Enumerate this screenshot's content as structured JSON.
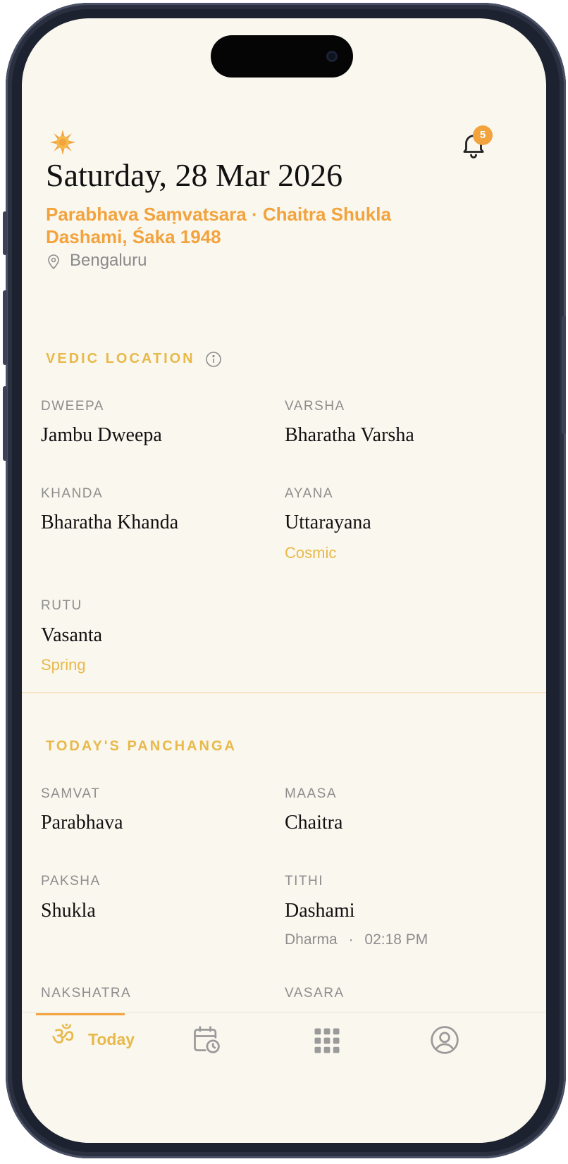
{
  "header": {
    "logo_icon": "sunburst-icon",
    "notification_count": "5",
    "date": "Saturday, 28 Mar 2026",
    "samvatsara_line": "Parabhava Saṃvatsara · Chaitra Shukla Dashami, Śaka 1948",
    "location": "Bengaluru"
  },
  "vedic_location": {
    "title": "VEDIC LOCATION",
    "items": [
      {
        "label": "DWEEPA",
        "value": "Jambu Dweepa"
      },
      {
        "label": "VARSHA",
        "value": "Bharatha Varsha"
      },
      {
        "label": "KHANDA",
        "value": "Bharatha Khanda"
      },
      {
        "label": "AYANA",
        "value": "Uttarayana",
        "sub": "Cosmic"
      },
      {
        "label": "RUTU",
        "value": "Vasanta",
        "sub": "Spring"
      }
    ]
  },
  "panchanga": {
    "title": "TODAY'S PANCHANGA",
    "items": [
      {
        "label": "SAMVAT",
        "value": "Parabhava"
      },
      {
        "label": "MAASA",
        "value": "Chaitra"
      },
      {
        "label": "PAKSHA",
        "value": "Shukla"
      },
      {
        "label": "TITHI",
        "value": "Dashami",
        "sub": "Dharma",
        "time": "02:18 PM"
      },
      {
        "label": "NAKSHATRA"
      },
      {
        "label": "VASARA"
      }
    ]
  },
  "tabbar": {
    "today_label": "Today",
    "icons": [
      "om-icon",
      "calendar-clock-icon",
      "grid-icon",
      "profile-icon"
    ]
  },
  "colors": {
    "accent": "#f2a33d",
    "gold": "#e8b94a",
    "background": "#faf7ef"
  }
}
